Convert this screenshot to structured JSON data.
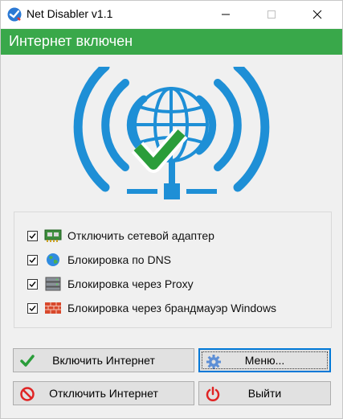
{
  "window": {
    "title": "Net Disabler v1.1",
    "controls": {
      "minimize": "—",
      "maximize": "☐",
      "close": "✕"
    }
  },
  "status": {
    "text": "Интернет включен",
    "color": "#39a84a"
  },
  "hero": {
    "icon": "wifi-globe-check-icon",
    "accent": "#1e8fd6",
    "check_color": "#2a9d3a"
  },
  "options": [
    {
      "label": "Отключить сетевой адаптер",
      "checked": true,
      "icon": "network-adapter-icon"
    },
    {
      "label": "Блокировка по DNS",
      "checked": true,
      "icon": "globe-icon"
    },
    {
      "label": "Блокировка через Proxy",
      "checked": true,
      "icon": "server-icon"
    },
    {
      "label": "Блокировка через брандмауэр Windows",
      "checked": true,
      "icon": "firewall-brick-icon"
    }
  ],
  "buttons": {
    "enable": {
      "label": "Включить Интернет",
      "icon": "green-check-icon"
    },
    "disable": {
      "label": "Отключить Интернет",
      "icon": "no-entry-icon"
    },
    "menu": {
      "label": "Меню...",
      "icon": "gear-icon"
    },
    "exit": {
      "label": "Выйти",
      "icon": "power-icon"
    }
  }
}
